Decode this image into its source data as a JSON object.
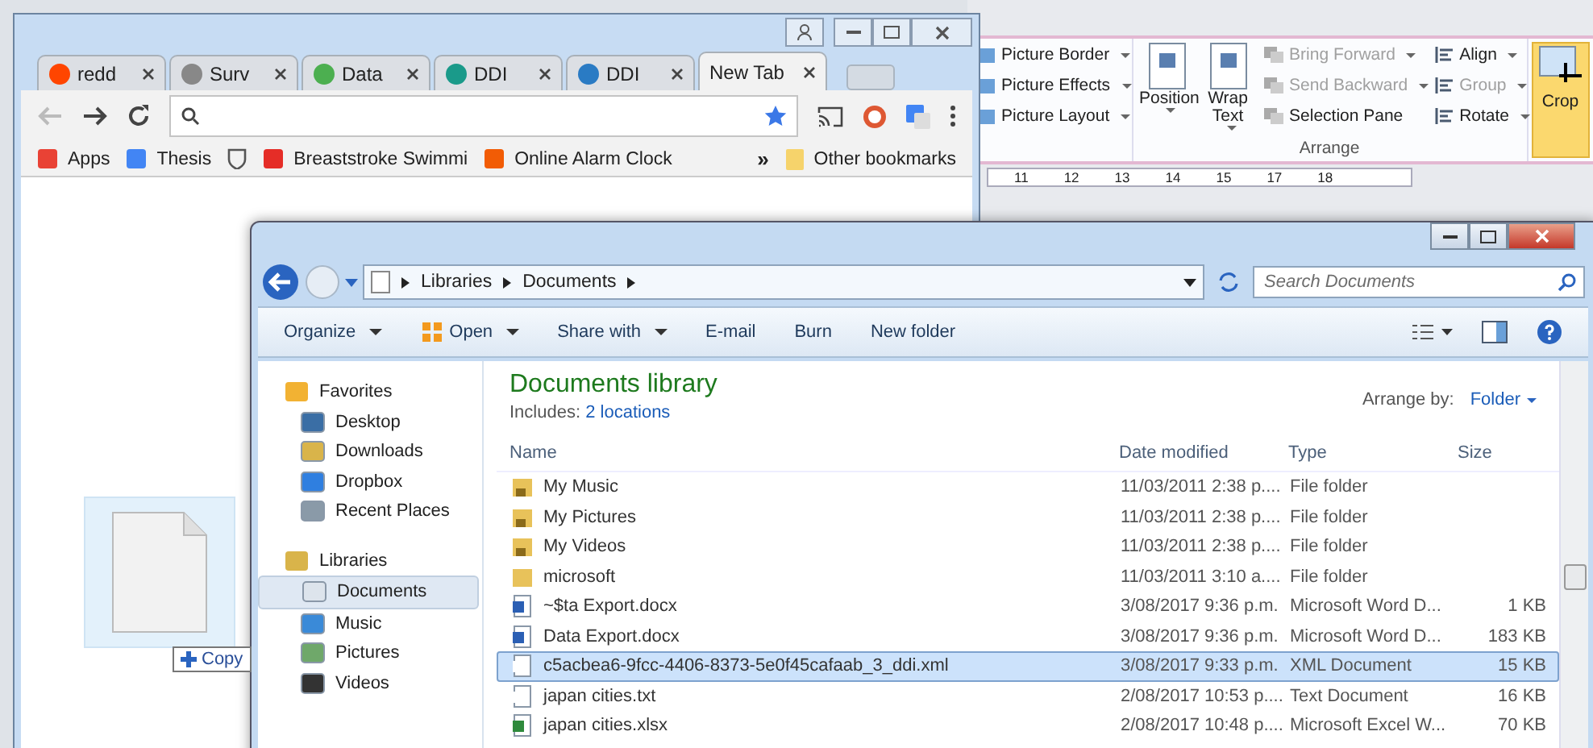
{
  "word": {
    "picture_items": [
      {
        "label": "Picture Border"
      },
      {
        "label": "Picture Effects"
      },
      {
        "label": "Picture Layout"
      }
    ],
    "arrange": {
      "big_buttons": [
        {
          "label": "Position"
        },
        {
          "label": "Wrap Text"
        }
      ],
      "column_1": [
        {
          "label": "Bring Forward",
          "disabled": true
        },
        {
          "label": "Send Backward",
          "disabled": true
        },
        {
          "label": "Selection Pane",
          "disabled": false
        }
      ],
      "column_2": [
        {
          "label": "Align",
          "disabled": false
        },
        {
          "label": "Group",
          "disabled": true
        },
        {
          "label": "Rotate",
          "disabled": false
        }
      ],
      "group_label": "Arrange"
    },
    "crop": {
      "label": "Crop",
      "selected": true
    },
    "ruler": [
      "11",
      "12",
      "13",
      "14",
      "15",
      "17",
      "18"
    ]
  },
  "browser": {
    "tabs": [
      {
        "label": "redd",
        "selected": false
      },
      {
        "label": "Surv",
        "selected": false
      },
      {
        "label": "Data",
        "selected": false
      },
      {
        "label": "DDI",
        "selected": false
      },
      {
        "label": "DDI",
        "selected": false
      },
      {
        "label": "New Tab",
        "selected": true
      }
    ],
    "bookmarks": [
      "Apps",
      "Thesis",
      "Breaststroke Swimmi",
      "Online Alarm Clock"
    ],
    "overflow": "»",
    "other_bookmarks": "Other bookmarks"
  },
  "explorer": {
    "breadcrumb": [
      "Libraries",
      "Documents"
    ],
    "search": {
      "placeholder": "Search Documents"
    },
    "toolbar": [
      "Organize",
      "Open",
      "Share with",
      "E-mail",
      "Burn",
      "New folder"
    ],
    "nav": [
      {
        "label": "Favorites",
        "children": [
          {
            "label": "Desktop",
            "selected": false
          },
          {
            "label": "Downloads",
            "selected": false
          },
          {
            "label": "Dropbox",
            "selected": false
          },
          {
            "label": "Recent Places",
            "selected": false
          }
        ]
      },
      {
        "label": "Libraries",
        "children": [
          {
            "label": "Documents",
            "selected": true
          },
          {
            "label": "Music",
            "selected": false
          },
          {
            "label": "Pictures",
            "selected": false
          },
          {
            "label": "Videos",
            "selected": false
          }
        ]
      }
    ],
    "library_title": "Documents library",
    "includes_label": "Includes:",
    "includes_link": "2 locations",
    "arrange_label": "Arrange by:",
    "arrange_value": "Folder",
    "columns": [
      "Name",
      "Date modified",
      "Type",
      "Size"
    ],
    "rows": [
      {
        "name": "My Music",
        "date": "11/03/2011 2:38 p....",
        "type": "File folder",
        "size": "",
        "kind": "locked",
        "selected": false
      },
      {
        "name": "My Pictures",
        "date": "11/03/2011 2:38 p....",
        "type": "File folder",
        "size": "",
        "kind": "locked",
        "selected": false
      },
      {
        "name": "My Videos",
        "date": "11/03/2011 2:38 p....",
        "type": "File folder",
        "size": "",
        "kind": "locked",
        "selected": false
      },
      {
        "name": "microsoft",
        "date": "11/03/2011 3:10 a....",
        "type": "File folder",
        "size": "",
        "kind": "folder",
        "selected": false
      },
      {
        "name": "~$ta Export.docx",
        "date": "3/08/2017 9:36 p.m.",
        "type": "Microsoft Word D...",
        "size": "1 KB",
        "kind": "word",
        "selected": false
      },
      {
        "name": "Data Export.docx",
        "date": "3/08/2017 9:36 p.m.",
        "type": "Microsoft Word D...",
        "size": "183 KB",
        "kind": "word",
        "selected": false
      },
      {
        "name": "c5acbea6-9fcc-4406-8373-5e0f45cafaab_3_ddi.xml",
        "date": "3/08/2017 9:33 p.m.",
        "type": "XML Document",
        "size": "15 KB",
        "kind": "file",
        "selected": true
      },
      {
        "name": "japan cities.txt",
        "date": "2/08/2017 10:53 p....",
        "type": "Text Document",
        "size": "16 KB",
        "kind": "file",
        "selected": false
      },
      {
        "name": "japan cities.xlsx",
        "date": "2/08/2017 10:48 p....",
        "type": "Microsoft Excel W...",
        "size": "70 KB",
        "kind": "excel",
        "selected": false
      }
    ]
  },
  "drag": {
    "badge": "Copy"
  }
}
